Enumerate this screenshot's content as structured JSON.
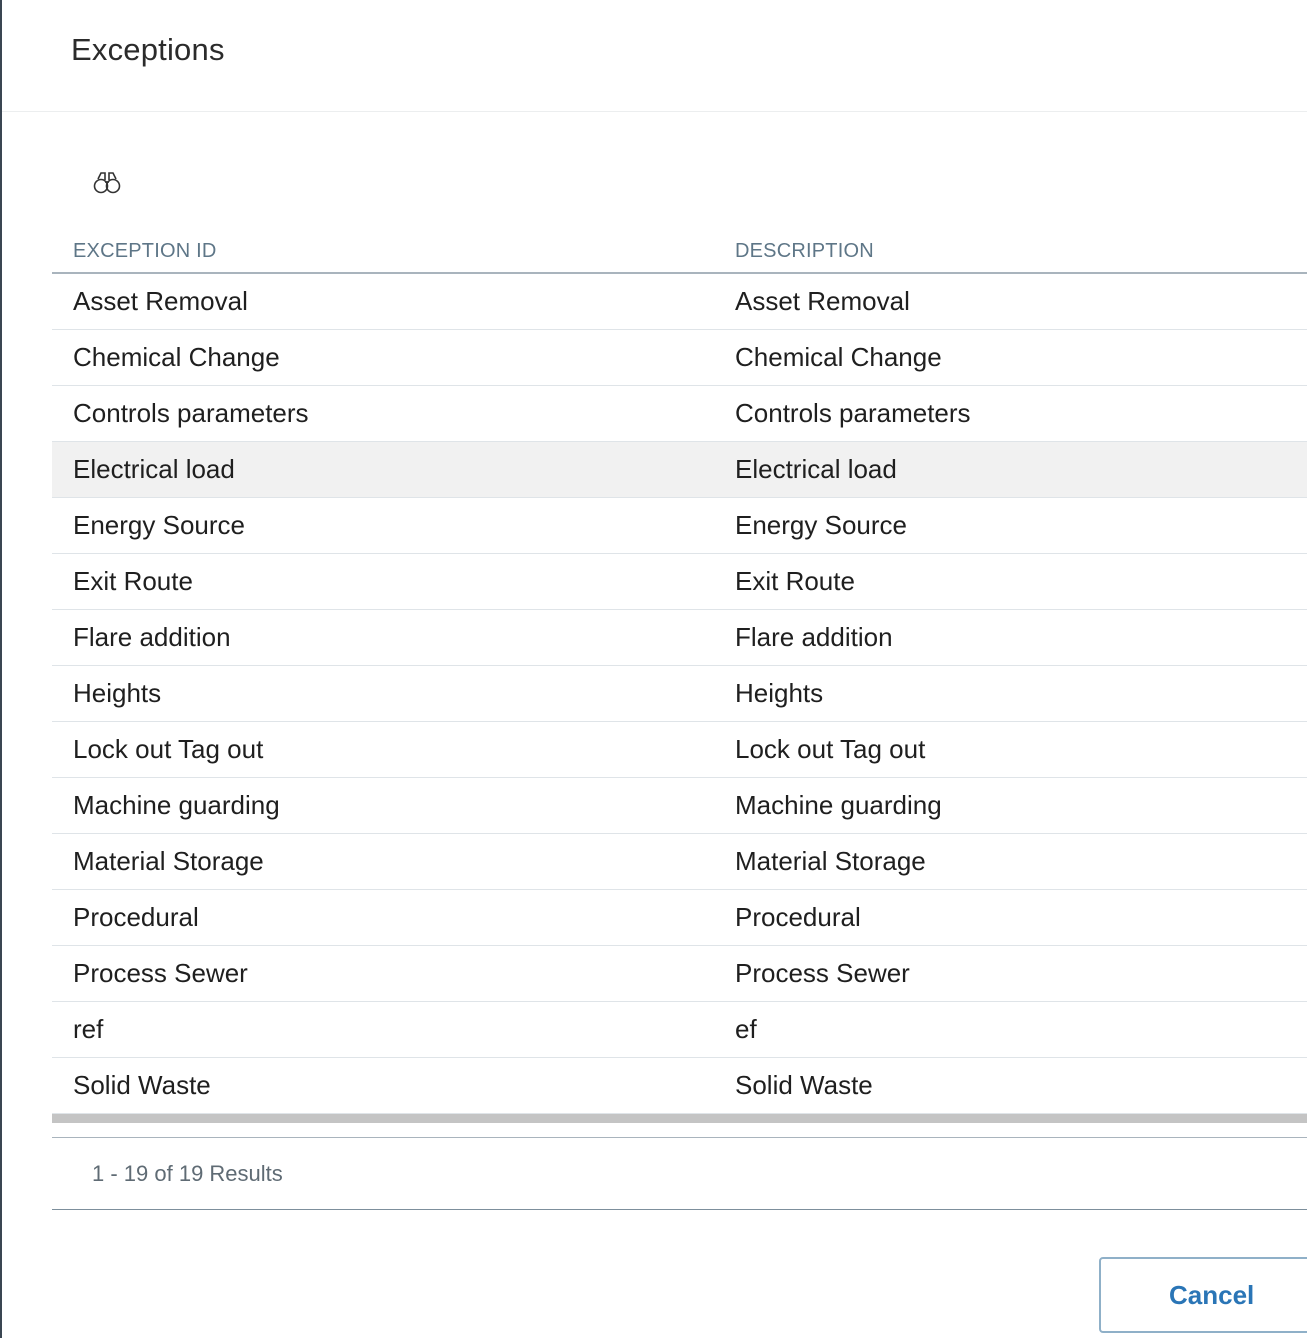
{
  "dialog": {
    "title": "Exceptions"
  },
  "toolbar": {
    "search_icon": "binoculars-icon"
  },
  "grid": {
    "columns": [
      "EXCEPTION ID",
      "DESCRIPTION"
    ],
    "rows": [
      {
        "id": "Asset Removal",
        "description": "Asset Removal"
      },
      {
        "id": "Chemical Change",
        "description": "Chemical Change"
      },
      {
        "id": "Controls parameters",
        "description": "Controls parameters"
      },
      {
        "id": "Electrical load",
        "description": "Electrical load"
      },
      {
        "id": "Energy Source",
        "description": "Energy Source"
      },
      {
        "id": "Exit Route",
        "description": "Exit Route"
      },
      {
        "id": "Flare addition",
        "description": "Flare addition"
      },
      {
        "id": "Heights",
        "description": "Heights"
      },
      {
        "id": "Lock out Tag out",
        "description": "Lock out Tag out"
      },
      {
        "id": "Machine guarding",
        "description": "Machine guarding"
      },
      {
        "id": "Material Storage",
        "description": "Material Storage"
      },
      {
        "id": "Procedural",
        "description": "Procedural"
      },
      {
        "id": "Process Sewer",
        "description": "Process Sewer"
      },
      {
        "id": "ref",
        "description": "ef"
      },
      {
        "id": "Solid Waste",
        "description": "Solid Waste"
      }
    ],
    "hovered_row_index": 3
  },
  "pager": {
    "summary": "1 - 19 of 19 Results"
  },
  "actions": {
    "cancel_label": "Cancel"
  }
}
